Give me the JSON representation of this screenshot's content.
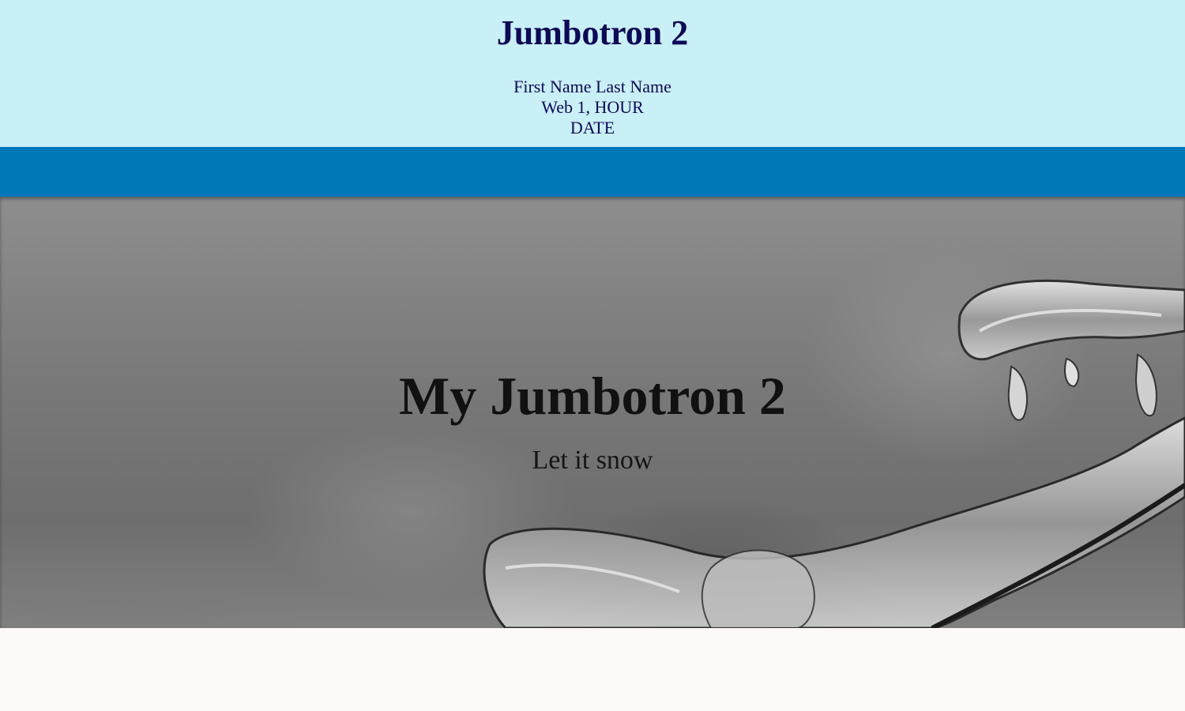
{
  "header": {
    "title": "Jumbotron 2",
    "byline": {
      "name": "First Name Last Name",
      "class_period": "Web 1, HOUR",
      "date": "DATE"
    }
  },
  "jumbotron": {
    "title": "My Jumbotron 2",
    "subtitle": "Let it snow",
    "background_image": "icy-branch-photo"
  },
  "colors": {
    "header_bg": "#c9eff7",
    "header_text": "#0d0a55",
    "navbar_bg": "#0077b6",
    "page_bg": "#fdf9f8"
  }
}
